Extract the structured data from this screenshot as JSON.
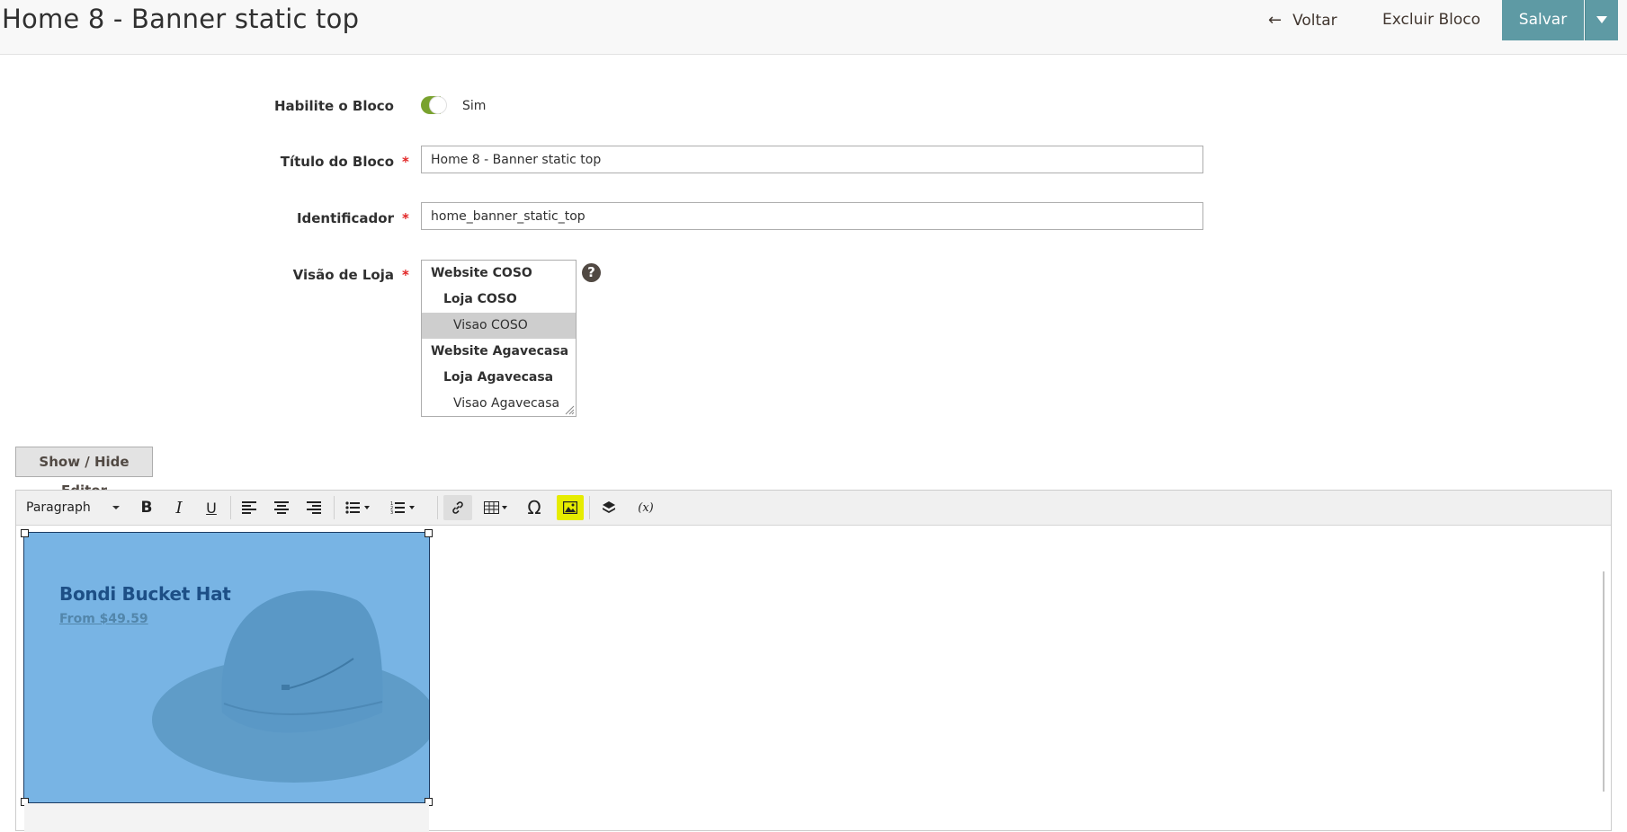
{
  "header": {
    "title": "Home 8 - Banner static top",
    "back_label": "Voltar",
    "delete_label": "Excluir Bloco",
    "save_label": "Salvar",
    "accent_color": "#5e9aa4"
  },
  "form": {
    "enable": {
      "label": "Habilite o Bloco",
      "value": "Sim",
      "checked": true
    },
    "title": {
      "label": "Título do Bloco",
      "value": "Home 8 - Banner static top"
    },
    "identifier": {
      "label": "Identificador",
      "value": "home_banner_static_top"
    },
    "store_view": {
      "label": "Visão de Loja",
      "options": [
        {
          "label": "Website COSO",
          "level": "group"
        },
        {
          "label": "Loja COSO",
          "level": "sub"
        },
        {
          "label": "Visao COSO",
          "level": "leaf",
          "selected": true
        },
        {
          "label": "Website Agavecasa",
          "level": "group"
        },
        {
          "label": "Loja Agavecasa",
          "level": "sub"
        },
        {
          "label": "Visao Agavecasa",
          "level": "leaf"
        }
      ],
      "help": "?"
    },
    "required_mark": "*"
  },
  "editor": {
    "toggle_label": "Show / Hide Editor",
    "format_value": "Paragraph",
    "toolbar_icons": [
      "bold-icon",
      "italic-icon",
      "underline-icon",
      "align-left-icon",
      "align-center-icon",
      "align-right-icon",
      "bullet-list-icon",
      "numbered-list-icon",
      "link-icon",
      "table-icon",
      "special-char-icon",
      "insert-image-icon",
      "widget-icon",
      "variable-icon"
    ],
    "highlight_color": "#e6ec00",
    "banner": {
      "title": "Bondi Bucket Hat",
      "price": "From $49.59",
      "background": "#78b4e4"
    }
  }
}
